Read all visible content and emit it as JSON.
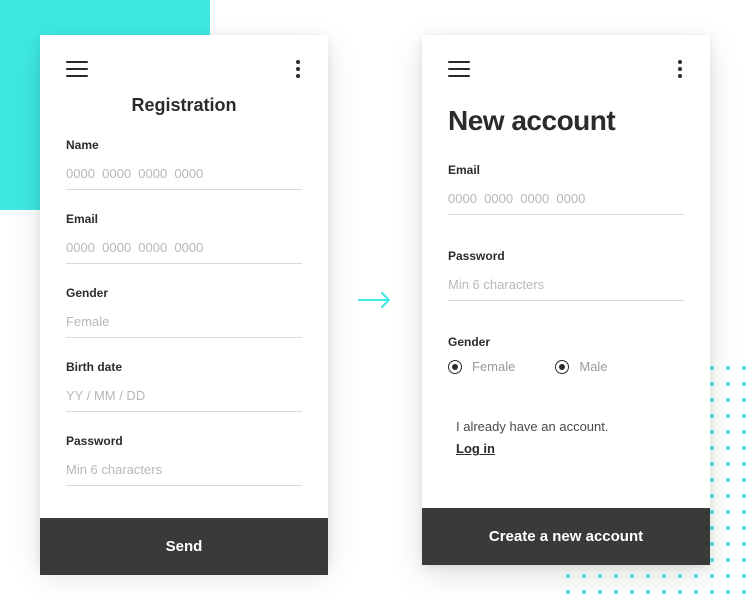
{
  "card1": {
    "title": "Registration",
    "fields": {
      "name": {
        "label": "Name",
        "placeholder": "0000  0000  0000  0000",
        "value": ""
      },
      "email": {
        "label": "Email",
        "placeholder": "0000  0000  0000  0000",
        "value": ""
      },
      "gender": {
        "label": "Gender",
        "placeholder": "Female",
        "value": ""
      },
      "birthdate": {
        "label": "Birth date",
        "placeholder": "YY / MM / DD",
        "value": ""
      },
      "password": {
        "label": "Password",
        "placeholder": "Min 6 characters",
        "value": ""
      }
    },
    "cta": "Send"
  },
  "card2": {
    "title": "New account",
    "fields": {
      "email": {
        "label": "Email",
        "placeholder": "0000  0000  0000  0000",
        "value": ""
      },
      "password": {
        "label": "Password",
        "placeholder": "Min 6 characters",
        "value": ""
      },
      "gender": {
        "label": "Gender",
        "options": [
          {
            "label": "Female",
            "selected": true
          },
          {
            "label": "Male",
            "selected": true
          }
        ]
      }
    },
    "existing_account_text": "I already have an account.",
    "login_link": "Log in",
    "cta": "Create a new account"
  },
  "colors": {
    "accent": "#3ee9e3",
    "dark": "#3a3a3a"
  }
}
